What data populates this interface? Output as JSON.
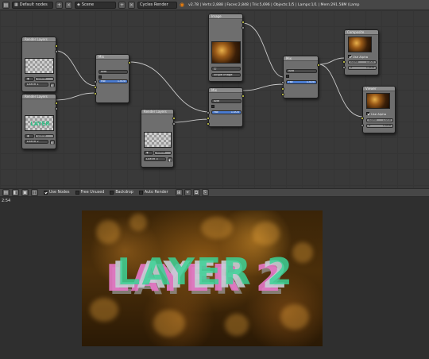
{
  "header": {
    "layout_name": "Default nodes",
    "scene_name": "Scene",
    "engine": "Cycles Render",
    "stats": "v2.78 | Verts:2,888 | Faces:2,848 | Tris:5,696 | Objects:1/5 | Lamps:1/1 | Mem:291.58M (Lamp"
  },
  "nodes": {
    "rl1": {
      "title": "Render Layers",
      "layer": "LAYER 1",
      "scene": "Scene"
    },
    "rl2": {
      "title": "Render Layers",
      "layer": "LAYER 2",
      "scene": "Scene",
      "thumb_text": "LAYER"
    },
    "rl3": {
      "title": "Render Layers",
      "layer": "LAYER 3",
      "scene": "Scene"
    },
    "image": {
      "title": "Image",
      "mode": "Single Image"
    },
    "mix1": {
      "title": "Mix",
      "blend": "Add",
      "fac_label": "Fac",
      "fac_value": "1.000"
    },
    "mix2": {
      "title": "Mix",
      "blend": "Add",
      "fac_label": "Fac",
      "fac_value": "1.000"
    },
    "mix3": {
      "title": "Mix",
      "blend": "Add",
      "fac_label": "Fac",
      "fac_value": "1.000"
    },
    "composite": {
      "title": "Composite",
      "use_alpha": "Use Alpha",
      "alpha_label": "Alpha",
      "alpha_value": "1.000",
      "z_label": "Z",
      "z_value": "1.000"
    },
    "viewer": {
      "title": "Viewer",
      "use_alpha": "Use Alpha",
      "alpha_label": "Alpha",
      "alpha_value": "1.000",
      "z_label": "Z",
      "z_value": "1.000"
    }
  },
  "node_bar": {
    "use_nodes": "Use Nodes",
    "free_unused": "Free Unused",
    "backdrop": "Backdrop",
    "auto_render": "Auto Render"
  },
  "viewer": {
    "zoom": "2:54",
    "render_text": "LAYER 2"
  },
  "colors": {
    "accent": "#4a7bd0",
    "socket_color": "#d9d94c",
    "wire": "#c8c8c8"
  }
}
